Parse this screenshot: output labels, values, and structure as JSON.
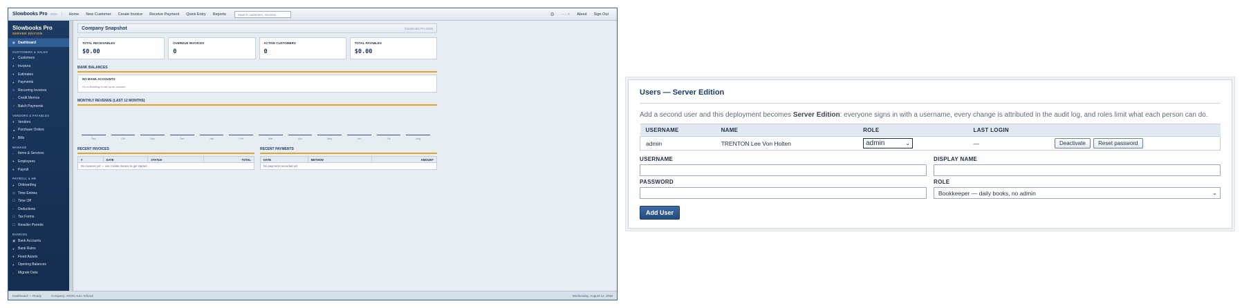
{
  "app": {
    "brand": "Slowbooks Pro",
    "brand_year": "2026",
    "nav": [
      "Home",
      "New Customer",
      "Create Invoice",
      "Receive Payment",
      "Quick Entry",
      "Reports"
    ],
    "search_placeholder": "Search customers, invoices...",
    "top_right": {
      "controls": "— ▫ ✕",
      "about": "About",
      "sign_out": "Sign Out"
    },
    "sidebar": {
      "title": "Slowbooks Pro",
      "subtitle": "SERVER EDITION",
      "groups": [
        {
          "heading": "",
          "items": [
            {
              "label": "Dashboard",
              "icon": "◼",
              "active": true
            }
          ]
        },
        {
          "heading": "CUSTOMERS & SALES",
          "items": [
            {
              "label": "Customers",
              "icon": "●"
            },
            {
              "label": "Invoices",
              "icon": "●"
            },
            {
              "label": "Estimates",
              "icon": "●"
            },
            {
              "label": "Payments",
              "icon": "●"
            },
            {
              "label": "Recurring Invoices",
              "icon": "↻"
            },
            {
              "label": "Credit Memos",
              "icon": "–"
            },
            {
              "label": "Batch Payments",
              "icon": "✓"
            }
          ]
        },
        {
          "heading": "VENDORS & PAYABLES",
          "items": [
            {
              "label": "Vendors",
              "icon": "●"
            },
            {
              "label": "Purchase Orders",
              "icon": "▲"
            },
            {
              "label": "Bills",
              "icon": "●"
            }
          ]
        },
        {
          "heading": "MANAGE",
          "items": [
            {
              "label": "Items & Services",
              "icon": "–"
            },
            {
              "label": "Employees",
              "icon": "●"
            },
            {
              "label": "Payroll",
              "icon": "●"
            }
          ]
        },
        {
          "heading": "PAYROLL & HR",
          "items": [
            {
              "label": "Onboarding",
              "icon": "●"
            },
            {
              "label": "Time Entries",
              "icon": "◷"
            },
            {
              "label": "Time Off",
              "icon": "☐"
            },
            {
              "label": "Deductions",
              "icon": "–"
            },
            {
              "label": "Tax Forms",
              "icon": "☐"
            },
            {
              "label": "Reseller Permits",
              "icon": "☐"
            }
          ]
        },
        {
          "heading": "BANKING",
          "items": [
            {
              "label": "Bank Accounts",
              "icon": "▣"
            },
            {
              "label": "Bank Rules",
              "icon": "●"
            },
            {
              "label": "Fixed Assets",
              "icon": "●"
            },
            {
              "label": "Opening Balances",
              "icon": "●"
            },
            {
              "label": "Migrate Data",
              "icon": "↓"
            }
          ]
        }
      ]
    },
    "status_bar": {
      "left": "Dashboard — Ready",
      "company": "Company: ARON Auto Yellows",
      "date": "Wednesday, August 12, 2026"
    }
  },
  "dashboard": {
    "title": "Company Snapshot",
    "edition_tag": "Slowbooks Pro 2026",
    "kpis": [
      {
        "label": "TOTAL RECEIVABLES",
        "value": "$0.00"
      },
      {
        "label": "OVERDUE INVOICES",
        "value": "0"
      },
      {
        "label": "ACTIVE CUSTOMERS",
        "value": "0"
      },
      {
        "label": "TOTAL PAYABLES",
        "value": "$0.00"
      }
    ],
    "bank": {
      "title": "BANK BALANCES",
      "empty_heading": "NO BANK ACCOUNTS",
      "empty_note": "Go to Banking to set up an account"
    },
    "revenue": {
      "title": "MONTHLY REVENUE (LAST 12 MONTHS)"
    },
    "recent_invoices": {
      "title": "RECENT INVOICES",
      "columns": [
        "#",
        "DATE",
        "STATUS",
        "TOTAL"
      ],
      "empty": "No invoices yet — use Create Invoice to get started"
    },
    "recent_payments": {
      "title": "RECENT PAYMENTS",
      "columns": [
        "DATE",
        "METHOD",
        "AMOUNT"
      ],
      "empty": "No payments recorded yet"
    }
  },
  "chart_data": {
    "type": "bar",
    "title": "MONTHLY REVENUE (LAST 12 MONTHS)",
    "categories": [
      "Sep",
      "Oct",
      "Nov",
      "Dec",
      "Jan",
      "Feb",
      "Mar",
      "Apr",
      "May",
      "Jun",
      "Jul",
      "Aug"
    ],
    "values": [
      0,
      0,
      0,
      0,
      0,
      0,
      0,
      0,
      0,
      0,
      0,
      0
    ],
    "xlabel": "",
    "ylabel": ""
  },
  "users": {
    "title": "Users — Server Edition",
    "desc_before": "Add a second user and this deployment becomes ",
    "desc_bold": "Server Edition",
    "desc_after": ": everyone signs in with a username, every change is attributed in the audit log, and roles limit what each person can do.",
    "columns": [
      "USERNAME",
      "NAME",
      "ROLE",
      "LAST LOGIN",
      ""
    ],
    "rows": [
      {
        "username": "admin",
        "name": "TRENTON Lee Von Holten",
        "role": "admin",
        "last_login": "—",
        "deactivate": "Deactivate",
        "reset": "Reset password"
      }
    ],
    "form": {
      "username_label": "USERNAME",
      "display_name_label": "DISPLAY NAME",
      "password_label": "PASSWORD",
      "role_label": "ROLE",
      "role_value": "Bookkeeper — daily books, no admin",
      "submit": "Add User"
    }
  }
}
